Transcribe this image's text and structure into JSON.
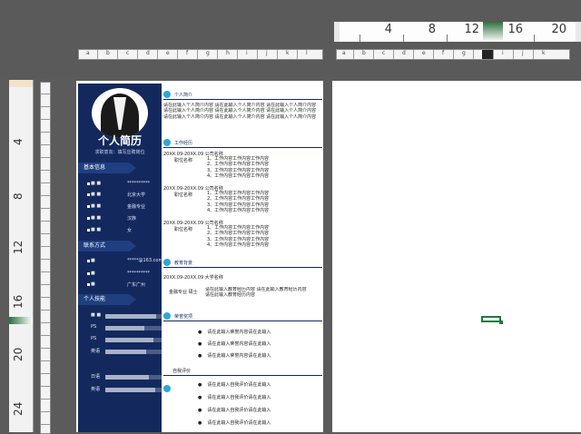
{
  "ruler": {
    "horizontal_numbers": [
      "4",
      "8",
      "12",
      "16",
      "20"
    ],
    "vertical_numbers": [
      "4",
      "8",
      "12",
      "16",
      "20",
      "24"
    ]
  },
  "resume": {
    "name": "个人简历",
    "intention": "求职意向：填写应聘岗位",
    "sections_left": {
      "basic": "基本信息",
      "contact": "联系方式",
      "skills": "个人技能"
    },
    "basic_info": [
      {
        "k": "■ ■",
        "v": "**********"
      },
      {
        "k": "■ ■",
        "v": "北京大学"
      },
      {
        "k": "■ ■",
        "v": "金融专业"
      },
      {
        "k": "■ ■",
        "v": "汉族"
      },
      {
        "k": "■ ■",
        "v": "女"
      }
    ],
    "contact_info": [
      {
        "k": "■",
        "v": "*****@163.com"
      },
      {
        "k": "■",
        "v": "**********"
      },
      {
        "k": "■",
        "v": "广东广州"
      }
    ],
    "skills": [
      {
        "k": "■ ■",
        "level": 0.9
      },
      {
        "k": "PS",
        "level": 0.7
      },
      {
        "k": "PS",
        "level": 0.85
      },
      {
        "k": "英语",
        "level": 0.72
      },
      {
        "k": "日语",
        "level": 0.78
      },
      {
        "k": "英语",
        "level": 0.88
      }
    ],
    "sections_right": {
      "intro": "个人简介",
      "work": "工作经历",
      "edu": "教育背景",
      "honor": "荣誉奖项",
      "self": "自我评价"
    },
    "intro_text": "请在此输入个人简介内容 请在此输入个人简介内容 请在此输入个人简介内容 请在此输入个人简介内容 请在此输入个人简介内容 请在此输入个人简介内容 请在此输入个人简介内容 请在此输入个人简介内容 请在此输入个人简介内容",
    "jobs": [
      {
        "head": "20XX.09-20XX.09 公司名称",
        "role": "职位名称",
        "items": [
          "1、工作内容工作内容工作内容",
          "2、工作内容工作内容工作内容",
          "3、工作内容工作内容工作内容",
          "4、工作内容工作内容工作内容"
        ]
      },
      {
        "head": "20XX.09-20XX.09 公司名称",
        "role": "职位名称",
        "items": [
          "1、工作内容工作内容工作内容",
          "2、工作内容工作内容工作内容",
          "3、工作内容工作内容工作内容",
          "4、工作内容工作内容工作内容"
        ]
      },
      {
        "head": "20XX.09-20XX.09 公司名称",
        "role": "职位名称",
        "items": [
          "1、工作内容工作内容工作内容",
          "2、工作内容工作内容工作内容",
          "3、工作内容工作内容工作内容",
          "4、工作内容工作内容工作内容"
        ]
      }
    ],
    "education": {
      "head": "20XX.09-20XX.09 大学名称",
      "major": "金融专业 硕士",
      "text": "请在此输入教育经历内容 请在此输入教育经历内容 请在此输入教育经历内容"
    },
    "honors": [
      "请在此输入荣誉内容请在此输入",
      "请在此输入荣誉内容请在此输入",
      "请在此输入荣誉内容请在此输入"
    ],
    "self_eval": [
      "请在此输入自我评价请在此输入",
      "请在此输入自我评价请在此输入",
      "请在此输入自我评价请在此输入",
      "请在此输入自我评价请在此输入"
    ]
  },
  "colors": {
    "sidebar": "#13295e",
    "accent": "#2aa7d8",
    "cell_cursor": "#1f7a3a"
  }
}
